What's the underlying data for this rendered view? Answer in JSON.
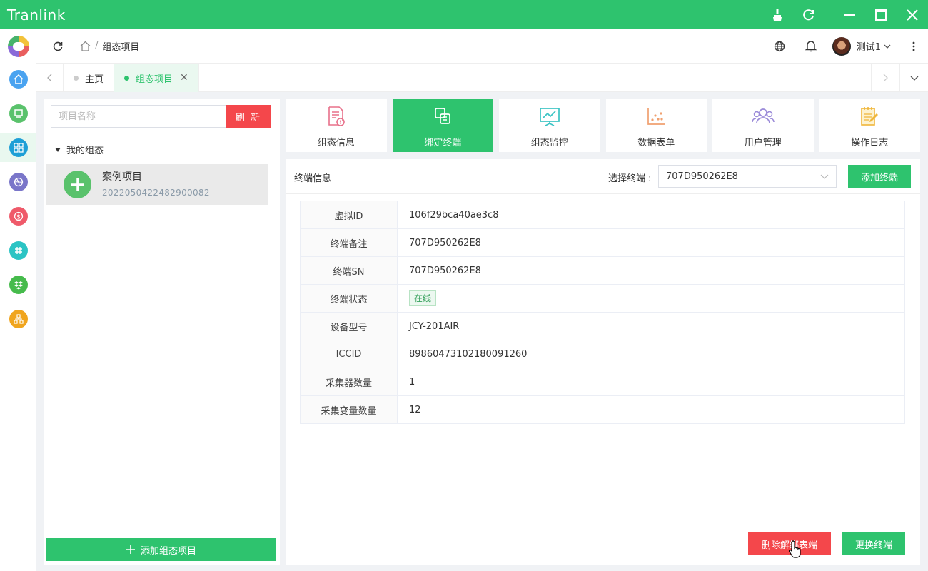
{
  "window": {
    "title": "Tranlink"
  },
  "header": {
    "breadcrumb": "组态项目",
    "username": "测试1"
  },
  "tabs": [
    {
      "label": "主页",
      "active": false
    },
    {
      "label": "组态项目",
      "active": true
    }
  ],
  "left_panel": {
    "search_placeholder": "项目名称",
    "refresh_label": "刷 新",
    "tree_label": "我的组态",
    "project": {
      "name": "案例项目",
      "id": "2022050422482900082"
    },
    "add_label": "添加组态项目"
  },
  "function_tiles": [
    {
      "label": "组态信息",
      "icon": "document-warning-icon",
      "active": false
    },
    {
      "label": "绑定终端",
      "icon": "copy-link-icon",
      "active": true
    },
    {
      "label": "组态监控",
      "icon": "presentation-chart-icon",
      "active": false
    },
    {
      "label": "数据表单",
      "icon": "scatter-chart-icon",
      "active": false
    },
    {
      "label": "用户管理",
      "icon": "users-icon",
      "active": false
    },
    {
      "label": "操作日志",
      "icon": "notepad-edit-icon",
      "active": false
    }
  ],
  "terminal": {
    "section_title": "终端信息",
    "select_label": "选择终端 :",
    "selected_terminal": "707D950262E8",
    "add_label": "添加终端",
    "rows": [
      {
        "key": "虚拟ID",
        "value": "106f29bca40ae3c8"
      },
      {
        "key": "终端备注",
        "value": "707D950262E8"
      },
      {
        "key": "终端SN",
        "value": "707D950262E8"
      },
      {
        "key": "终端状态",
        "value": "在线"
      },
      {
        "key": "设备型号",
        "value": "JCY-201AIR"
      },
      {
        "key": "ICCID",
        "value": "89860473102180091260"
      },
      {
        "key": "采集器数量",
        "value": "1"
      },
      {
        "key": "采集变量数量",
        "value": "12"
      }
    ],
    "delete_label": "删除解绑表端",
    "swap_label": "更换终端"
  },
  "colors": {
    "primary": "#2ec36e",
    "danger": "#f4474b"
  }
}
